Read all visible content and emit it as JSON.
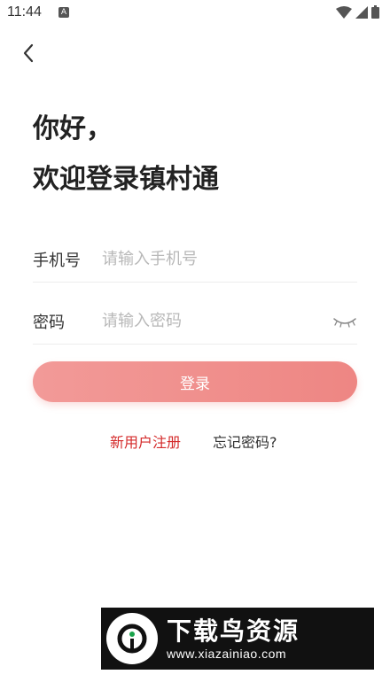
{
  "status_bar": {
    "time": "11:44",
    "notification_icon": "a-icon",
    "icons": [
      "wifi-icon",
      "signal-icon",
      "battery-icon"
    ]
  },
  "nav": {
    "back_icon": "chevron-left-icon"
  },
  "header": {
    "greeting": "你好，",
    "welcome": "欢迎登录镇村通"
  },
  "form": {
    "phone_label": "手机号",
    "phone_placeholder": "请输入手机号",
    "phone_value": "",
    "password_label": "密码",
    "password_placeholder": "请输入密码",
    "password_value": "",
    "password_toggle_icon": "eye-closed-icon",
    "login_label": "登录"
  },
  "links": {
    "register": "新用户注册",
    "forgot": "忘记密码?"
  },
  "watermark": {
    "title": "下载鸟资源",
    "url": "www.xiazainiao.com"
  },
  "colors": {
    "accent": "#ee8683",
    "link_red": "#d42a2a",
    "text": "#222222",
    "placeholder": "#b8b8b8"
  }
}
